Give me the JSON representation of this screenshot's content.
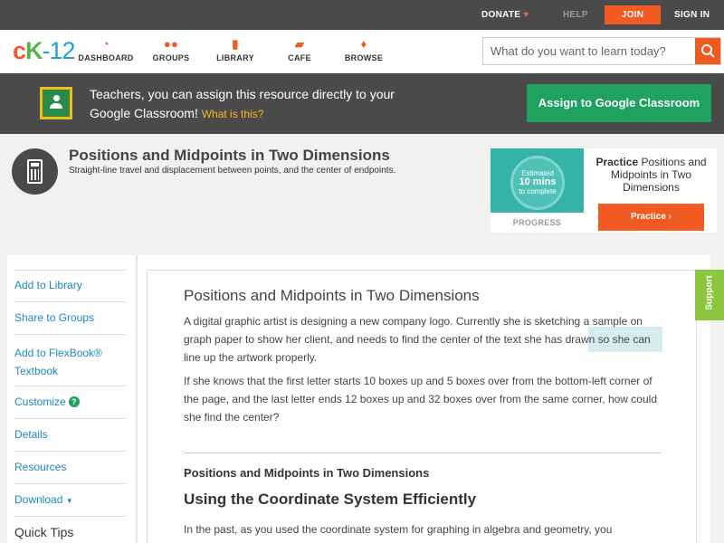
{
  "topbar": {
    "donate": "DONATE",
    "help": "HELP",
    "join": "JOIN",
    "signin": "SIGN IN"
  },
  "logo": {
    "c": "c",
    "k": "K",
    "num": "-12"
  },
  "nav": {
    "items": [
      {
        "label": "DASHBOARD",
        "icon": "dashboard-icon"
      },
      {
        "label": "GROUPS",
        "icon": "groups-icon"
      },
      {
        "label": "LIBRARY",
        "icon": "library-icon"
      },
      {
        "label": "CAFE",
        "icon": "cafe-icon"
      },
      {
        "label": "BROWSE",
        "icon": "browse-icon"
      }
    ],
    "search_placeholder": "What do you want to learn today?"
  },
  "banner": {
    "text": "Teachers, you can assign this resource directly to your Google Classroom!",
    "what": "What is this?",
    "button": "Assign to Google Classroom"
  },
  "concept": {
    "title": "Positions and Midpoints in Two Dimensions",
    "subtitle": "Straight-line travel and displacement between points, and the center of endpoints."
  },
  "practice": {
    "estimated": "Estimated",
    "mins": "10 mins",
    "to_complete": "to complete",
    "progress": "PROGRESS",
    "title_bold": "Practice",
    "title_rest": "Positions and Midpoints in Two Dimensions",
    "button": "Practice"
  },
  "sidebar": {
    "items": [
      "Add to Library",
      "Share to Groups",
      "Add to FlexBook® Textbook",
      "Customize",
      "Details",
      "Resources",
      "Download"
    ],
    "quick_tips": "Quick Tips"
  },
  "article": {
    "title": "Positions and Midpoints in Two Dimensions",
    "para1": "A digital graphic artist is designing a new company logo. Currently she is sketching a sample on graph paper to show her client, and needs to find the center of the text she has drawn so she can line up the artwork properly.",
    "para2": "If she knows that the first letter starts 10 boxes up and 5 boxes over from the bottom-left corner of the page, and the last letter ends 12 boxes up and 32 boxes over from the same corner, how could she find the center?",
    "h3": "Positions and Midpoints in Two Dimensions",
    "h2": "Using the Coordinate System Efficiently",
    "para3": "In the past, as you used the coordinate system for graphing in algebra and geometry, you"
  },
  "support": "Support",
  "colors": {
    "brand_orange": "#f15a22",
    "green": "#1fa15f",
    "dark_bar": "#4a4a4a",
    "link_blue": "#1d86c4"
  }
}
